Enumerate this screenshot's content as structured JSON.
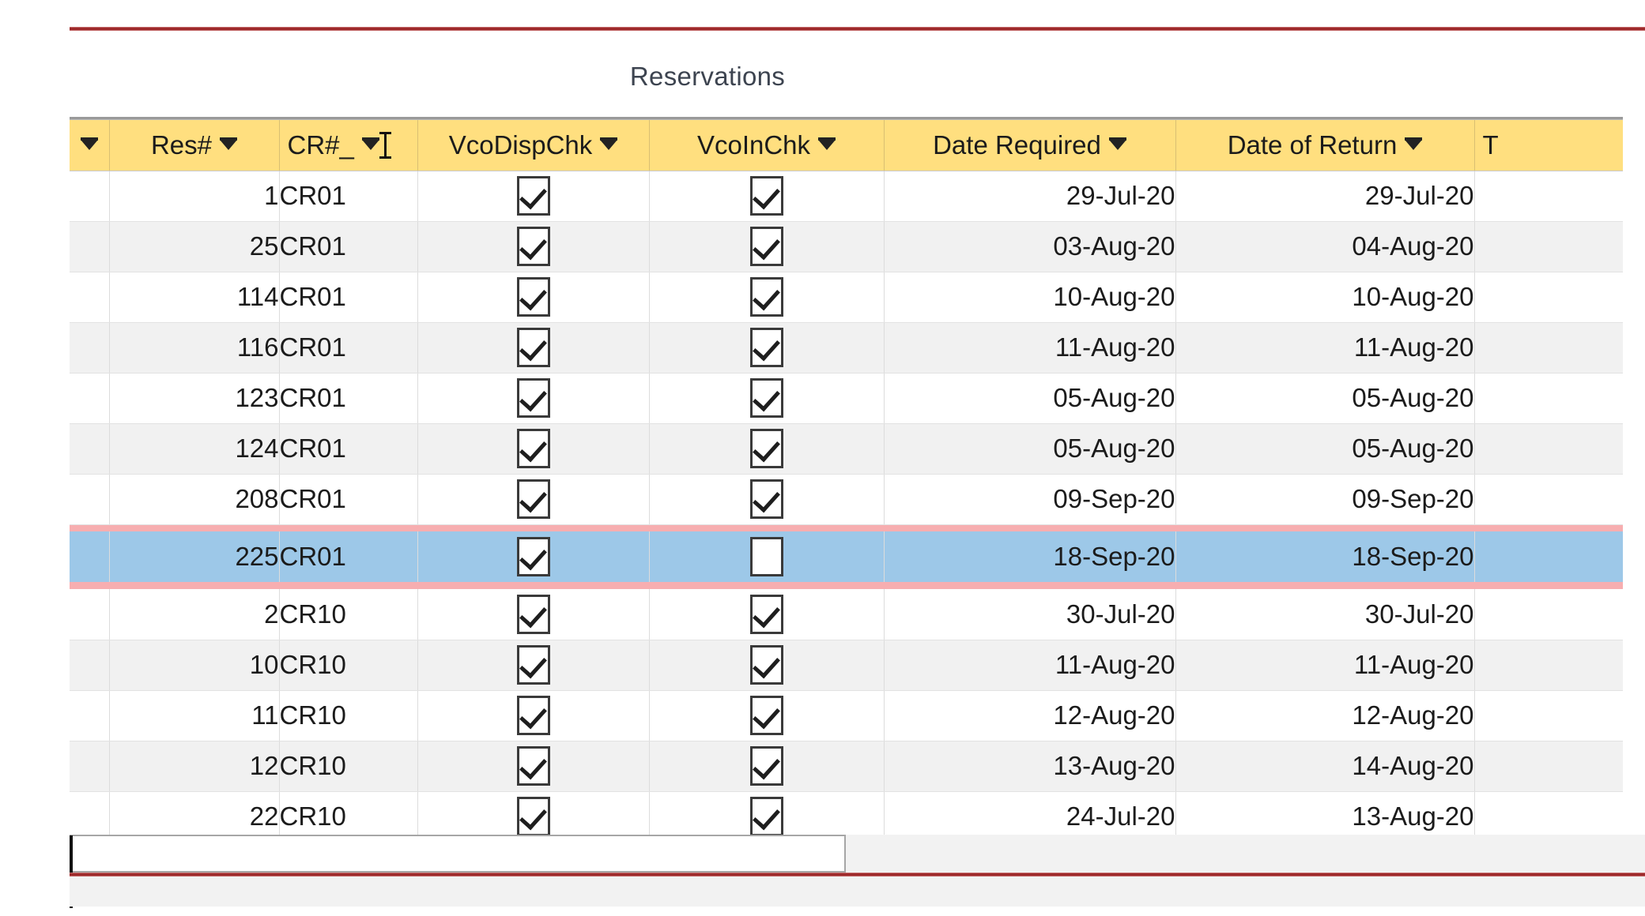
{
  "caption": "Reservations",
  "accents": {
    "rule_red": "#9e2a2b",
    "header_yellow": "#ffdf7f",
    "selected_row_blue": "#9dc8e8",
    "selected_rule_pink": "#f7aeb0",
    "alt_row_gray": "#f1f1f1"
  },
  "table": {
    "name": "Reservations",
    "columns": [
      {
        "key": "rowsel",
        "label": "",
        "align": "center",
        "filter_arrow": true,
        "sort_indicator": false
      },
      {
        "key": "res",
        "label": "Res#",
        "align": "right",
        "filter_arrow": true,
        "sort_indicator": false
      },
      {
        "key": "cr",
        "label": "CR#_",
        "align": "left",
        "filter_arrow": true,
        "sort_indicator": true
      },
      {
        "key": "disp",
        "label": "VcoDispChk",
        "align": "center",
        "filter_arrow": true,
        "sort_indicator": false
      },
      {
        "key": "in",
        "label": "VcoInChk",
        "align": "center",
        "filter_arrow": true,
        "sort_indicator": false
      },
      {
        "key": "req",
        "label": "Date Required",
        "align": "right",
        "filter_arrow": true,
        "sort_indicator": false
      },
      {
        "key": "ret",
        "label": "Date of Return",
        "align": "right",
        "filter_arrow": true,
        "sort_indicator": false
      },
      {
        "key": "trunc",
        "label": "T",
        "align": "left",
        "filter_arrow": false,
        "sort_indicator": false
      }
    ],
    "rows": [
      {
        "res": "1",
        "cr": "CR01",
        "disp": true,
        "in": true,
        "req": "29-Jul-20",
        "ret": "29-Jul-20",
        "selected": false
      },
      {
        "res": "25",
        "cr": "CR01",
        "disp": true,
        "in": true,
        "req": "03-Aug-20",
        "ret": "04-Aug-20",
        "selected": false
      },
      {
        "res": "114",
        "cr": "CR01",
        "disp": true,
        "in": true,
        "req": "10-Aug-20",
        "ret": "10-Aug-20",
        "selected": false
      },
      {
        "res": "116",
        "cr": "CR01",
        "disp": true,
        "in": true,
        "req": "11-Aug-20",
        "ret": "11-Aug-20",
        "selected": false
      },
      {
        "res": "123",
        "cr": "CR01",
        "disp": true,
        "in": true,
        "req": "05-Aug-20",
        "ret": "05-Aug-20",
        "selected": false
      },
      {
        "res": "124",
        "cr": "CR01",
        "disp": true,
        "in": true,
        "req": "05-Aug-20",
        "ret": "05-Aug-20",
        "selected": false
      },
      {
        "res": "208",
        "cr": "CR01",
        "disp": true,
        "in": true,
        "req": "09-Sep-20",
        "ret": "09-Sep-20",
        "selected": false
      },
      {
        "res": "225",
        "cr": "CR01",
        "disp": true,
        "in": false,
        "req": "18-Sep-20",
        "ret": "18-Sep-20",
        "selected": true
      },
      {
        "res": "2",
        "cr": "CR10",
        "disp": true,
        "in": true,
        "req": "30-Jul-20",
        "ret": "30-Jul-20",
        "selected": false
      },
      {
        "res": "10",
        "cr": "CR10",
        "disp": true,
        "in": true,
        "req": "11-Aug-20",
        "ret": "11-Aug-20",
        "selected": false
      },
      {
        "res": "11",
        "cr": "CR10",
        "disp": true,
        "in": true,
        "req": "12-Aug-20",
        "ret": "12-Aug-20",
        "selected": false
      },
      {
        "res": "12",
        "cr": "CR10",
        "disp": true,
        "in": true,
        "req": "13-Aug-20",
        "ret": "14-Aug-20",
        "selected": false
      },
      {
        "res": "22",
        "cr": "CR10",
        "disp": true,
        "in": true,
        "req": "24-Jul-20",
        "ret": "13-Aug-20",
        "selected": false
      }
    ]
  },
  "new_record_row": {
    "value": "",
    "placeholder": ""
  }
}
